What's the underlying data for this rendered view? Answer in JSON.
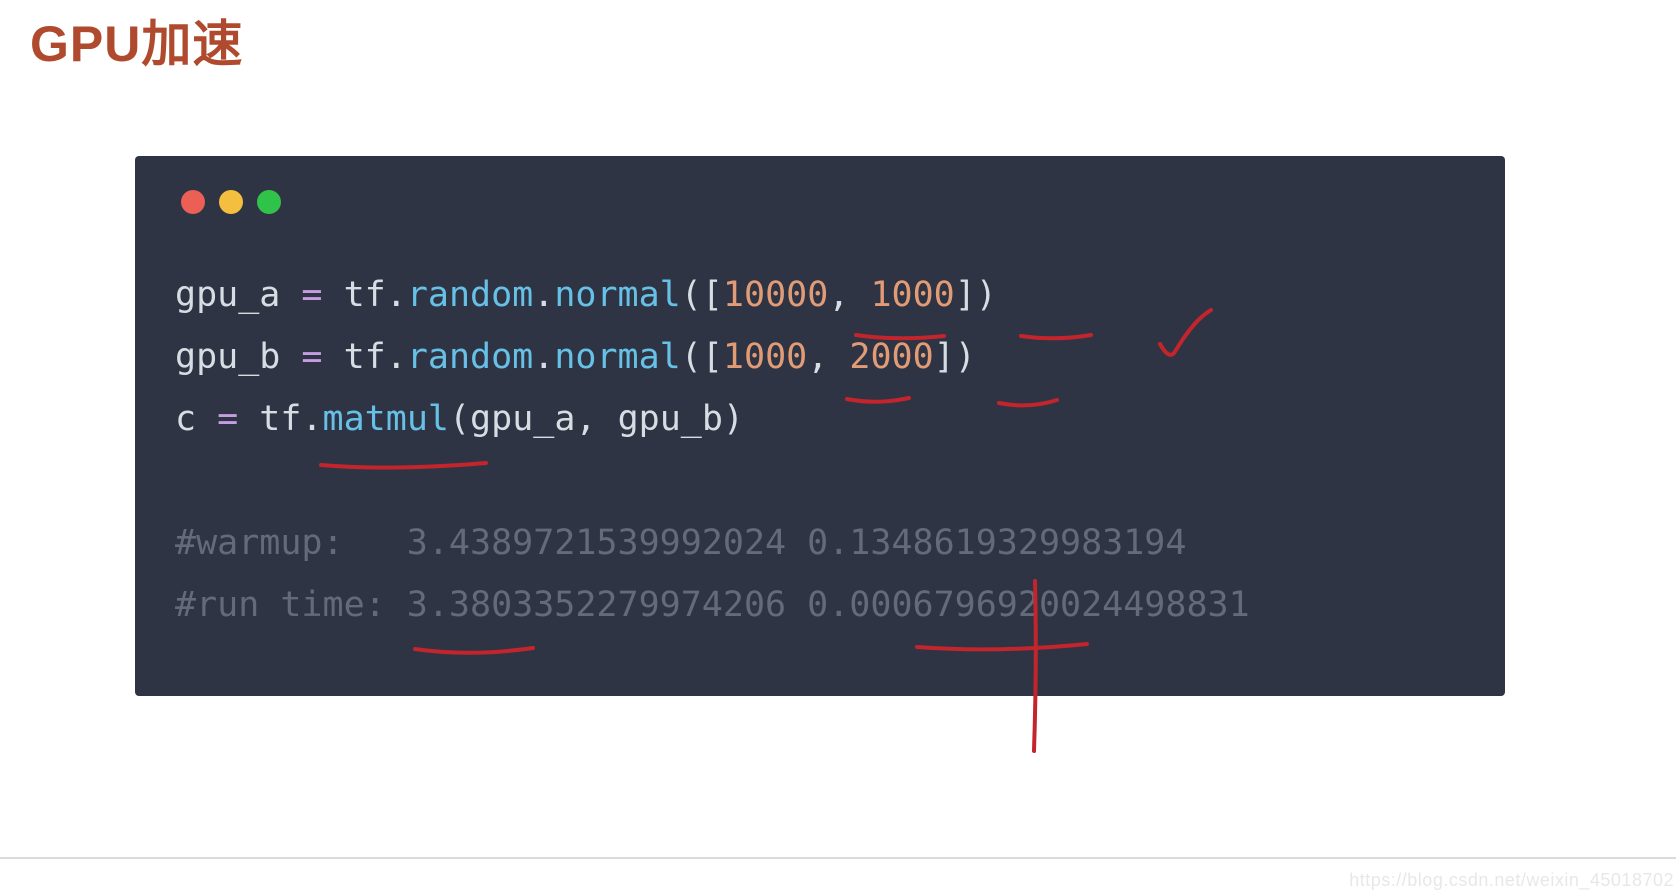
{
  "title": "GPU加速",
  "code": {
    "line1": {
      "var": "gpu_a",
      "eq": " = ",
      "tf": "tf",
      "dot1": ".",
      "random": "random",
      "dot2": ".",
      "normal": "normal",
      "open": "([",
      "n1": "10000",
      "comma": ", ",
      "n2": "1000",
      "close": "])"
    },
    "line2": {
      "var": "gpu_b",
      "eq": " = ",
      "tf": "tf",
      "dot1": ".",
      "random": "random",
      "dot2": ".",
      "normal": "normal",
      "open": "([",
      "n1": "1000",
      "comma": ", ",
      "n2": "2000",
      "close": "])"
    },
    "line3": {
      "var": "c",
      "eq": " = ",
      "tf": "tf",
      "dot1": ".",
      "matmul": "matmul",
      "open": "(",
      "arg1": "gpu_a",
      "comma": ", ",
      "arg2": "gpu_b",
      "close": ")"
    },
    "comment1": "#warmup:   3.4389721539992024 0.1348619329983194",
    "comment2": "#run time: 3.3803352279974206 0.0006796920024498831"
  },
  "watermark": "https://blog.csdn.net/weixin_45018702"
}
